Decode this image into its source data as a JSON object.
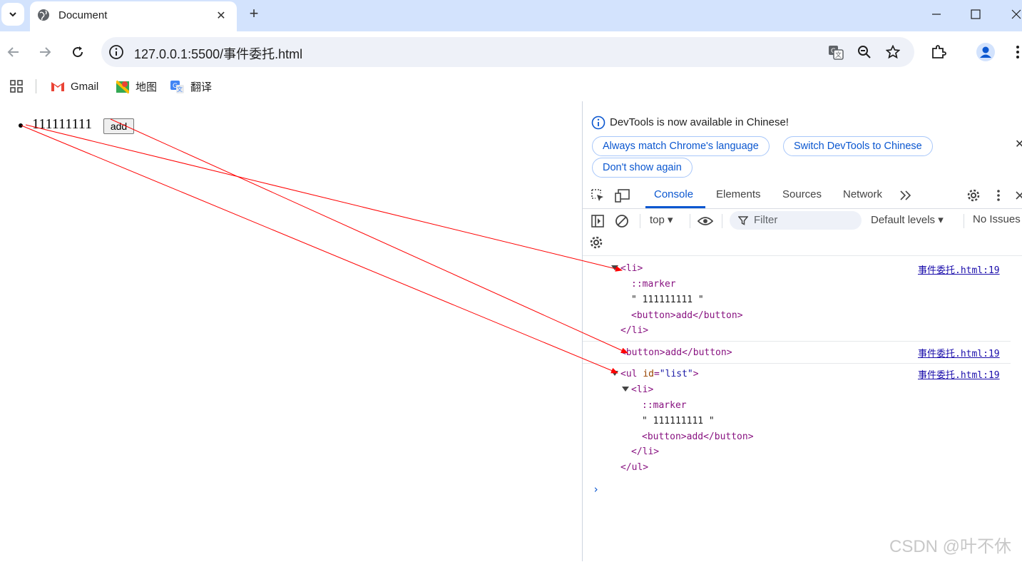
{
  "browser": {
    "tab": {
      "title": "Document"
    },
    "url": "127.0.0.1:5500/事件委托.html",
    "bookmarks": [
      {
        "label": "Gmail",
        "icon": "gmail-icon"
      },
      {
        "label": "地图",
        "icon": "maps-icon"
      },
      {
        "label": "翻译",
        "icon": "translate-icon"
      }
    ]
  },
  "page": {
    "list_item_text": "111111111",
    "button_label": "add"
  },
  "devtools": {
    "banner": {
      "message": "DevTools is now available in Chinese!",
      "buttons": [
        "Always match Chrome's language",
        "Switch DevTools to Chinese",
        "Don't show again"
      ]
    },
    "tabs": [
      "Console",
      "Elements",
      "Sources",
      "Network"
    ],
    "active_tab": "Console",
    "console_bar": {
      "context": "top ▾",
      "filter_placeholder": "Filter",
      "levels": "Default levels ▾",
      "issues": "No Issues"
    },
    "logs": [
      {
        "source": "事件委托.html:19",
        "lines": [
          "<li>",
          "::marker",
          "\" 111111111 \"",
          "<button>add</button>",
          "</li>"
        ]
      },
      {
        "source": "事件委托.html:19",
        "lines": [
          "<button>add</button>"
        ]
      },
      {
        "source": "事件委托.html:19",
        "lines": [
          "<ul id=\"list\">",
          "<li>",
          "::marker",
          "\" 111111111 \"",
          "<button>add</button>",
          "</li>",
          "</ul>"
        ]
      }
    ]
  },
  "watermark": "CSDN @叶不休",
  "colors": {
    "accent": "#0b57d0",
    "tabstrip": "#d3e3fd",
    "annotation_arrow": "#ff0000"
  }
}
